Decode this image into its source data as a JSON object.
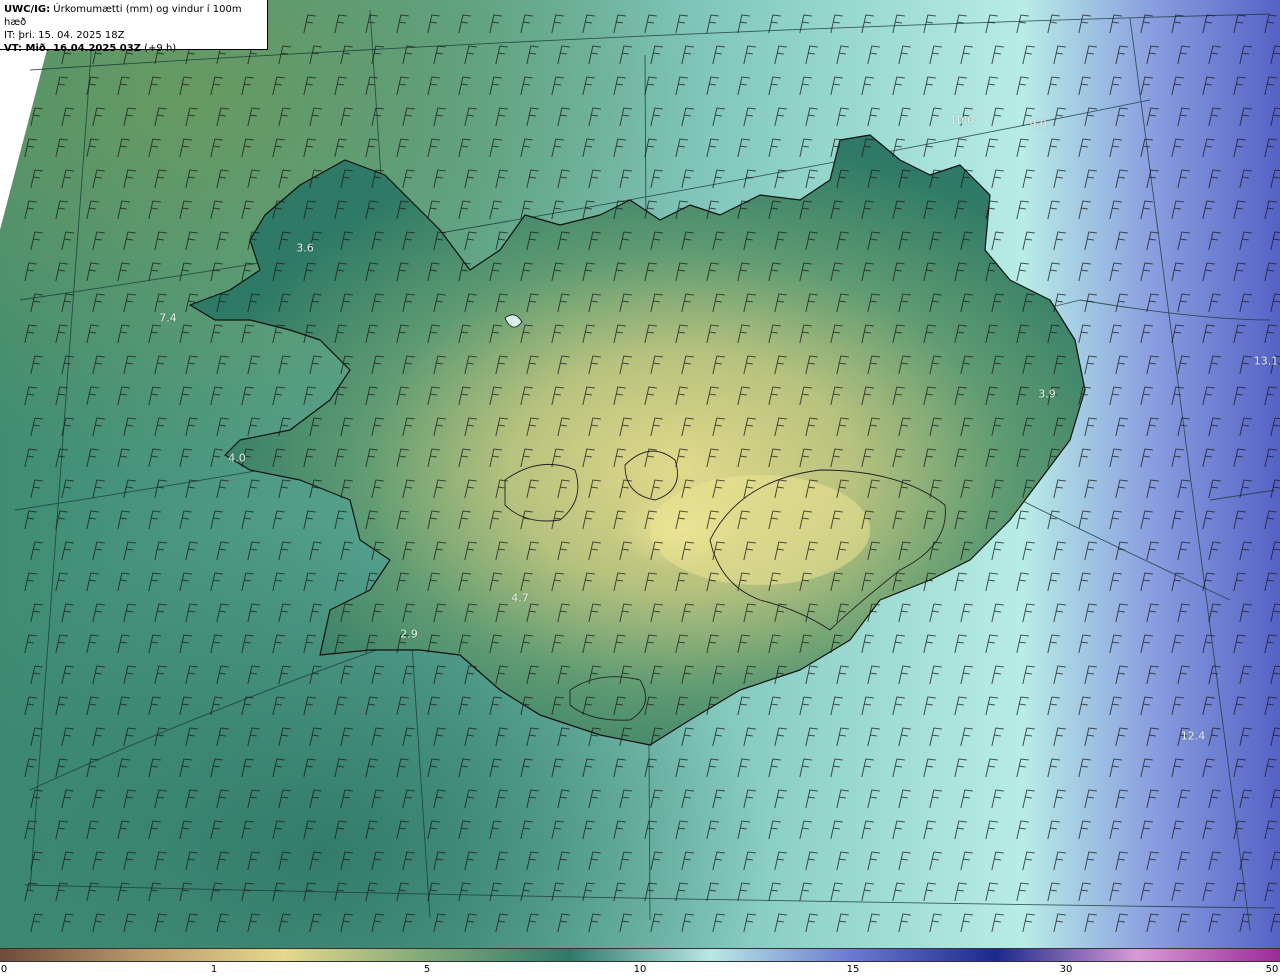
{
  "header": {
    "model": "UWC/IG:",
    "title": "Úrkomumætti (mm) og vindur í 100m hæð",
    "it_line": "IT: þri. 15. 04. 2025 18Z",
    "vt_label": "VT: Mið. 16.04.2025 03Z",
    "vt_offset": "(+9 h)"
  },
  "colorbar": {
    "ticks": [
      "0",
      "1",
      "5",
      "10",
      "15",
      "30",
      "50"
    ],
    "colors": [
      "#6e4b3a",
      "#b89a6a",
      "#e6d88c",
      "#7fa878",
      "#2e7a6a",
      "#b8e8e6",
      "#6a78d0",
      "#1a2a8a",
      "#d89ad8",
      "#9a2a9a"
    ]
  },
  "point_labels": [
    {
      "text": "3.6"
    },
    {
      "text": "7.4"
    },
    {
      "text": "4.0"
    },
    {
      "text": "2.9"
    },
    {
      "text": "4.7"
    },
    {
      "text": "3.9"
    },
    {
      "text": "10.0"
    },
    {
      "text": "9.0"
    },
    {
      "text": "13.1"
    },
    {
      "text": "12.4"
    }
  ]
}
